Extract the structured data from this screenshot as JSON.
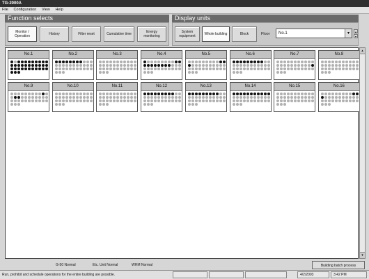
{
  "window": {
    "title": "TG-2000A"
  },
  "menu": [
    "File",
    "Configuration",
    "View",
    "Help"
  ],
  "function_selects": {
    "header": "Function selects",
    "buttons": [
      {
        "label": "Monitor / Operation",
        "active": true
      },
      {
        "label": "History",
        "active": false
      },
      {
        "label": "Filter reset",
        "active": false
      },
      {
        "label": "Cumulative time",
        "active": false
      },
      {
        "label": "Energy monitoring",
        "active": false
      }
    ]
  },
  "display_units": {
    "header": "Display units",
    "buttons": [
      {
        "label": "System equipment",
        "active": false
      },
      {
        "label": "Whole building",
        "active": true
      },
      {
        "label": "Block",
        "active": false
      }
    ],
    "floor_label": "Floor",
    "floor_value": "No.1"
  },
  "units": [
    {
      "name": "No.1",
      "on": [
        1,
        0,
        1,
        1,
        1,
        1,
        1,
        1,
        1,
        1,
        1,
        1,
        1,
        1,
        1,
        1,
        1,
        1,
        1,
        1,
        1,
        1,
        1,
        1,
        1,
        1,
        1,
        1,
        1,
        1,
        1,
        1,
        1,
        1,
        1,
        1
      ]
    },
    {
      "name": "No.2",
      "on": [
        1,
        1,
        1,
        1,
        1,
        1,
        1,
        1,
        0,
        0,
        0,
        0,
        0,
        0,
        0,
        0,
        0,
        0,
        0,
        0,
        0,
        0,
        0,
        0,
        0,
        0,
        0,
        0,
        0,
        0,
        0,
        0,
        0,
        0,
        0,
        0
      ]
    },
    {
      "name": "No.3",
      "on": [
        0,
        0,
        0,
        0,
        0,
        0,
        0,
        0,
        0,
        0,
        0,
        0,
        0,
        0,
        0,
        0,
        0,
        0,
        0,
        0,
        0,
        0,
        0,
        0,
        0,
        0,
        0,
        0,
        0,
        0,
        0,
        0,
        0,
        0,
        0,
        0
      ]
    },
    {
      "name": "No.4",
      "on": [
        1,
        0,
        0,
        0,
        0,
        0,
        0,
        0,
        0,
        1,
        1,
        1,
        1,
        1,
        1,
        1,
        1,
        1,
        1,
        0,
        0,
        0,
        0,
        0,
        0,
        0,
        0,
        0,
        0,
        0,
        0,
        0,
        0,
        0,
        0,
        0
      ]
    },
    {
      "name": "No.5",
      "on": [
        0,
        0,
        0,
        0,
        0,
        0,
        0,
        0,
        0,
        1,
        1,
        1,
        0,
        0,
        0,
        0,
        0,
        0,
        0,
        0,
        0,
        0,
        0,
        0,
        0,
        0,
        0,
        0,
        0,
        0,
        0,
        0,
        0,
        0,
        0,
        0
      ]
    },
    {
      "name": "No.6",
      "on": [
        1,
        1,
        1,
        1,
        1,
        1,
        1,
        1,
        1,
        0,
        0,
        0,
        0,
        0,
        0,
        0,
        0,
        0,
        0,
        0,
        0,
        0,
        0,
        0,
        0,
        0,
        0,
        0,
        0,
        0,
        0,
        0,
        0,
        0,
        0,
        0
      ]
    },
    {
      "name": "No.7",
      "on": [
        0,
        0,
        0,
        0,
        0,
        0,
        0,
        0,
        0,
        0,
        0,
        0,
        0,
        0,
        0,
        0,
        0,
        0,
        0,
        0,
        0,
        1,
        0,
        0,
        0,
        0,
        0,
        0,
        0,
        0,
        0,
        0,
        0,
        0,
        0,
        0
      ]
    },
    {
      "name": "No.8",
      "on": [
        0,
        0,
        0,
        0,
        0,
        0,
        0,
        0,
        0,
        0,
        0,
        0,
        0,
        0,
        0,
        0,
        0,
        0,
        0,
        0,
        0,
        0,
        0,
        0,
        0,
        0,
        0,
        0,
        0,
        0,
        0,
        0,
        0,
        0,
        0,
        0
      ]
    },
    {
      "name": "No.9",
      "on": [
        0,
        0,
        0,
        0,
        0,
        0,
        0,
        0,
        0,
        1,
        0,
        0,
        1,
        1,
        0,
        0,
        0,
        0,
        0,
        0,
        0,
        0,
        0,
        0,
        0,
        0,
        0,
        0,
        0,
        0,
        0,
        0,
        0,
        0,
        0,
        0
      ]
    },
    {
      "name": "No.10",
      "on": [
        0,
        0,
        0,
        0,
        0,
        0,
        0,
        0,
        0,
        0,
        0,
        0,
        0,
        0,
        0,
        0,
        0,
        0,
        0,
        0,
        0,
        0,
        0,
        0,
        0,
        0,
        0,
        0,
        0,
        0,
        0,
        0,
        0,
        0,
        0,
        0
      ]
    },
    {
      "name": "No.11",
      "on": [
        0,
        0,
        0,
        0,
        0,
        0,
        0,
        0,
        0,
        0,
        0,
        0,
        0,
        0,
        0,
        0,
        0,
        0,
        0,
        0,
        0,
        0,
        0,
        0,
        0,
        0,
        0,
        0,
        0,
        0,
        0,
        0,
        0,
        0,
        0,
        0
      ]
    },
    {
      "name": "No.12",
      "on": [
        1,
        1,
        1,
        1,
        1,
        1,
        1,
        1,
        1,
        0,
        0,
        0,
        0,
        0,
        0,
        0,
        0,
        0,
        0,
        0,
        0,
        0,
        0,
        0,
        0,
        0,
        0,
        0,
        0,
        0,
        0,
        0,
        0,
        0,
        0,
        0
      ]
    },
    {
      "name": "No.13",
      "on": [
        1,
        1,
        1,
        1,
        1,
        1,
        1,
        1,
        1,
        0,
        0,
        0,
        0,
        0,
        0,
        0,
        0,
        0,
        0,
        0,
        0,
        0,
        0,
        0,
        0,
        0,
        0,
        0,
        0,
        0,
        0,
        0,
        0,
        0,
        0,
        0
      ]
    },
    {
      "name": "No.14",
      "on": [
        1,
        1,
        1,
        1,
        1,
        1,
        1,
        1,
        1,
        1,
        1,
        0,
        0,
        0,
        0,
        0,
        0,
        0,
        0,
        0,
        0,
        0,
        0,
        0,
        0,
        0,
        0,
        0,
        0,
        0,
        0,
        0,
        0,
        0,
        0,
        0
      ]
    },
    {
      "name": "No.15",
      "on": [
        0,
        0,
        0,
        0,
        0,
        0,
        0,
        0,
        0,
        0,
        0,
        0,
        0,
        0,
        0,
        0,
        0,
        0,
        0,
        0,
        0,
        0,
        0,
        0,
        0,
        0,
        0,
        0,
        0,
        0,
        0,
        0,
        0,
        0,
        0,
        0
      ]
    },
    {
      "name": "No.16",
      "on": [
        0,
        0,
        0,
        0,
        0,
        0,
        0,
        0,
        0,
        1,
        1,
        1,
        0,
        0,
        0,
        0,
        0,
        0,
        0,
        0,
        0,
        0,
        0,
        0,
        0,
        0,
        0,
        0,
        0,
        0,
        0,
        0,
        0,
        0,
        0,
        0
      ]
    }
  ],
  "status_items": [
    {
      "label": "G-50",
      "value": "Normal"
    },
    {
      "label": "Etc. Unit",
      "value": "Normal"
    },
    {
      "label": "WHM",
      "value": "Normal"
    }
  ],
  "batch_button": "Building batch process",
  "statusbar": {
    "message": "Run, prohibit and schedule operations for the entire building are possible.",
    "date": "4/2/2003",
    "time": "3:42 PM"
  },
  "colors": {
    "dot_on": "#111111",
    "dot_off": "#b0b0b0",
    "header": "#6a6a6a"
  }
}
